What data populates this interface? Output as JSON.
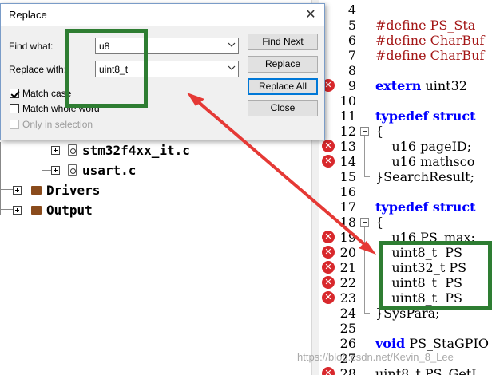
{
  "dialog": {
    "title": "Replace",
    "close_glyph": "✕",
    "find_label": "Find what:",
    "find_value": "u8",
    "replace_label": "Replace with:",
    "replace_value": "uint8_t",
    "buttons": {
      "find_next": "Find Next",
      "replace": "Replace",
      "replace_all": "Replace All",
      "close": "Close"
    },
    "options": {
      "match_case": {
        "label": "Match case",
        "checked": true
      },
      "match_whole_word": {
        "label": "Match whole word",
        "checked": false
      },
      "only_in_selection": {
        "label": "Only in selection",
        "checked": false,
        "disabled": true
      }
    }
  },
  "tree": {
    "items": [
      {
        "label": "stm32f4xx_it.c",
        "type": "file"
      },
      {
        "label": "usart.c",
        "type": "file"
      },
      {
        "label": "Drivers",
        "type": "folder"
      },
      {
        "label": "Output",
        "type": "folder"
      }
    ]
  },
  "editor": {
    "lines": [
      {
        "n": "4",
        "text": "",
        "err": false
      },
      {
        "n": "5",
        "text": "#define PS_Sta",
        "err": false,
        "pp": true
      },
      {
        "n": "6",
        "text": "#define CharBuf",
        "err": false,
        "pp": true
      },
      {
        "n": "7",
        "text": "#define CharBuf",
        "err": false,
        "pp": true
      },
      {
        "n": "8",
        "text": "",
        "err": false
      },
      {
        "n": "9",
        "text": "extern uint32_",
        "err": true,
        "kw": "extern"
      },
      {
        "n": "10",
        "text": "",
        "err": false
      },
      {
        "n": "11",
        "text": "typedef struct",
        "err": false,
        "kw": "typedef struct"
      },
      {
        "n": "12",
        "text": "{",
        "err": false
      },
      {
        "n": "13",
        "text": "    u16 pageID;",
        "err": true
      },
      {
        "n": "14",
        "text": "    u16 mathsco",
        "err": true
      },
      {
        "n": "15",
        "text": "}SearchResult;",
        "err": false
      },
      {
        "n": "16",
        "text": "",
        "err": false
      },
      {
        "n": "17",
        "text": "typedef struct",
        "err": false,
        "kw": "typedef struct"
      },
      {
        "n": "18",
        "text": "{",
        "err": false
      },
      {
        "n": "19",
        "text": "    u16 PS_max;",
        "err": true
      },
      {
        "n": "20",
        "text": "    uint8_t  PS",
        "err": true
      },
      {
        "n": "21",
        "text": "    uint32_t PS",
        "err": true
      },
      {
        "n": "22",
        "text": "    uint8_t  PS",
        "err": true
      },
      {
        "n": "23",
        "text": "    uint8_t  PS",
        "err": true
      },
      {
        "n": "24",
        "text": "}SysPara;",
        "err": false
      },
      {
        "n": "25",
        "text": "",
        "err": false
      },
      {
        "n": "26",
        "text": "void PS_StaGPIO",
        "err": false,
        "kw": "void"
      },
      {
        "n": "27",
        "text": "",
        "err": false
      },
      {
        "n": "28",
        "text": "uint8_t PS_GetI",
        "err": true
      }
    ]
  },
  "watermark": "https://blog.csdn.net/Kevin_8_Lee",
  "colors": {
    "annotation_green": "#2e7d32",
    "arrow_red": "#e53935",
    "error_red": "#d8282c",
    "keyword_blue": "#0000ff"
  },
  "icons": [
    "close-icon",
    "chevron-down-icon",
    "file-icon",
    "folder-icon",
    "expand-icon",
    "error-icon",
    "fold-icon"
  ]
}
